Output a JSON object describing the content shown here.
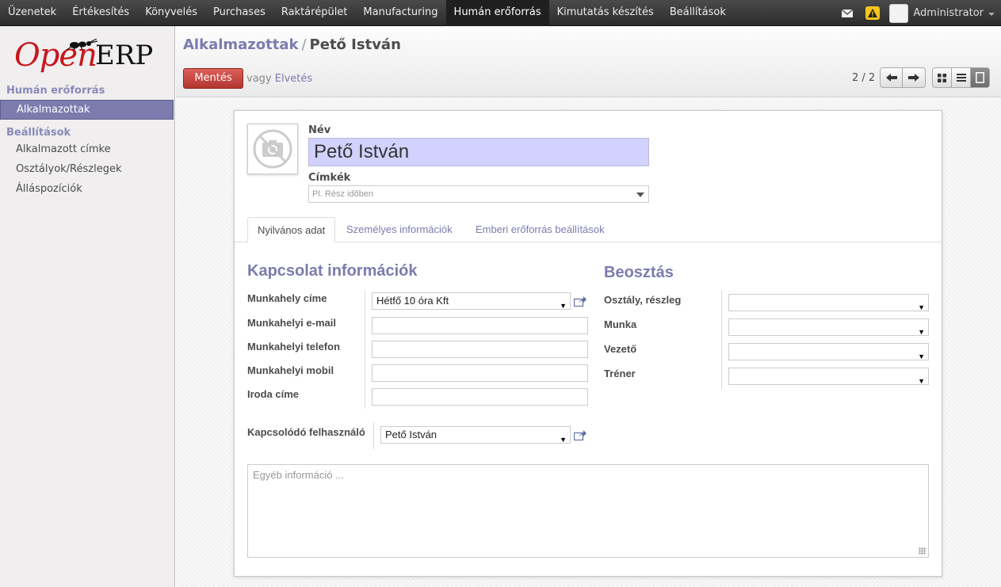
{
  "topbar": {
    "menu": [
      "Üzenetek",
      "Értékesítés",
      "Könyvelés",
      "Purchases",
      "Raktárépület",
      "Manufacturing",
      "Humán erőforrás",
      "Kimutatás készítés",
      "Beállítások"
    ],
    "active_menu_index": 6,
    "user": "Administrator",
    "icons": [
      "mail-icon",
      "warning-icon"
    ],
    "warning_color": "#f5c518"
  },
  "sidebar": {
    "logo_open": "Open",
    "logo_erp": "ERP",
    "section1": "Humán erőforrás",
    "section1_items": [
      "Alkalmazottak"
    ],
    "section2": "Beállítások",
    "section2_items": [
      "Alkalmazott címke",
      "Osztályok/Részlegek",
      "Álláspozíciók"
    ],
    "accent_color": "#7c7bad"
  },
  "header": {
    "breadcrumb_parent": "Alkalmazottak",
    "breadcrumb_sep": "/",
    "breadcrumb_current": "Pető István",
    "save_label": "Mentés",
    "or_label": "vagy",
    "discard_label": "Elvetés",
    "pager": "2 / 2"
  },
  "form": {
    "name_label": "Név",
    "name_value": "Pető István",
    "tags_label": "Címkék",
    "tags_placeholder": "Pl. Rész időben",
    "tabs": [
      "Nyilvános adat",
      "Személyes információk",
      "Emberi erőforrás beállítások"
    ],
    "active_tab_index": 0,
    "contact": {
      "title": "Kapcsolat információk",
      "work_address_label": "Munkahely címe",
      "work_address_value": "Hétfő 10 óra Kft",
      "work_email_label": "Munkahelyi e-mail",
      "work_phone_label": "Munkahelyi telefon",
      "work_mobile_label": "Munkahelyi mobil",
      "office_label": "Iroda címe",
      "related_user_label": "Kapcsolódó felhasználó",
      "related_user_value": "Pető István"
    },
    "position": {
      "title": "Beosztás",
      "department_label": "Osztály, részleg",
      "job_label": "Munka",
      "manager_label": "Vezető",
      "coach_label": "Tréner"
    },
    "notes_placeholder": "Egyéb információ ..."
  }
}
